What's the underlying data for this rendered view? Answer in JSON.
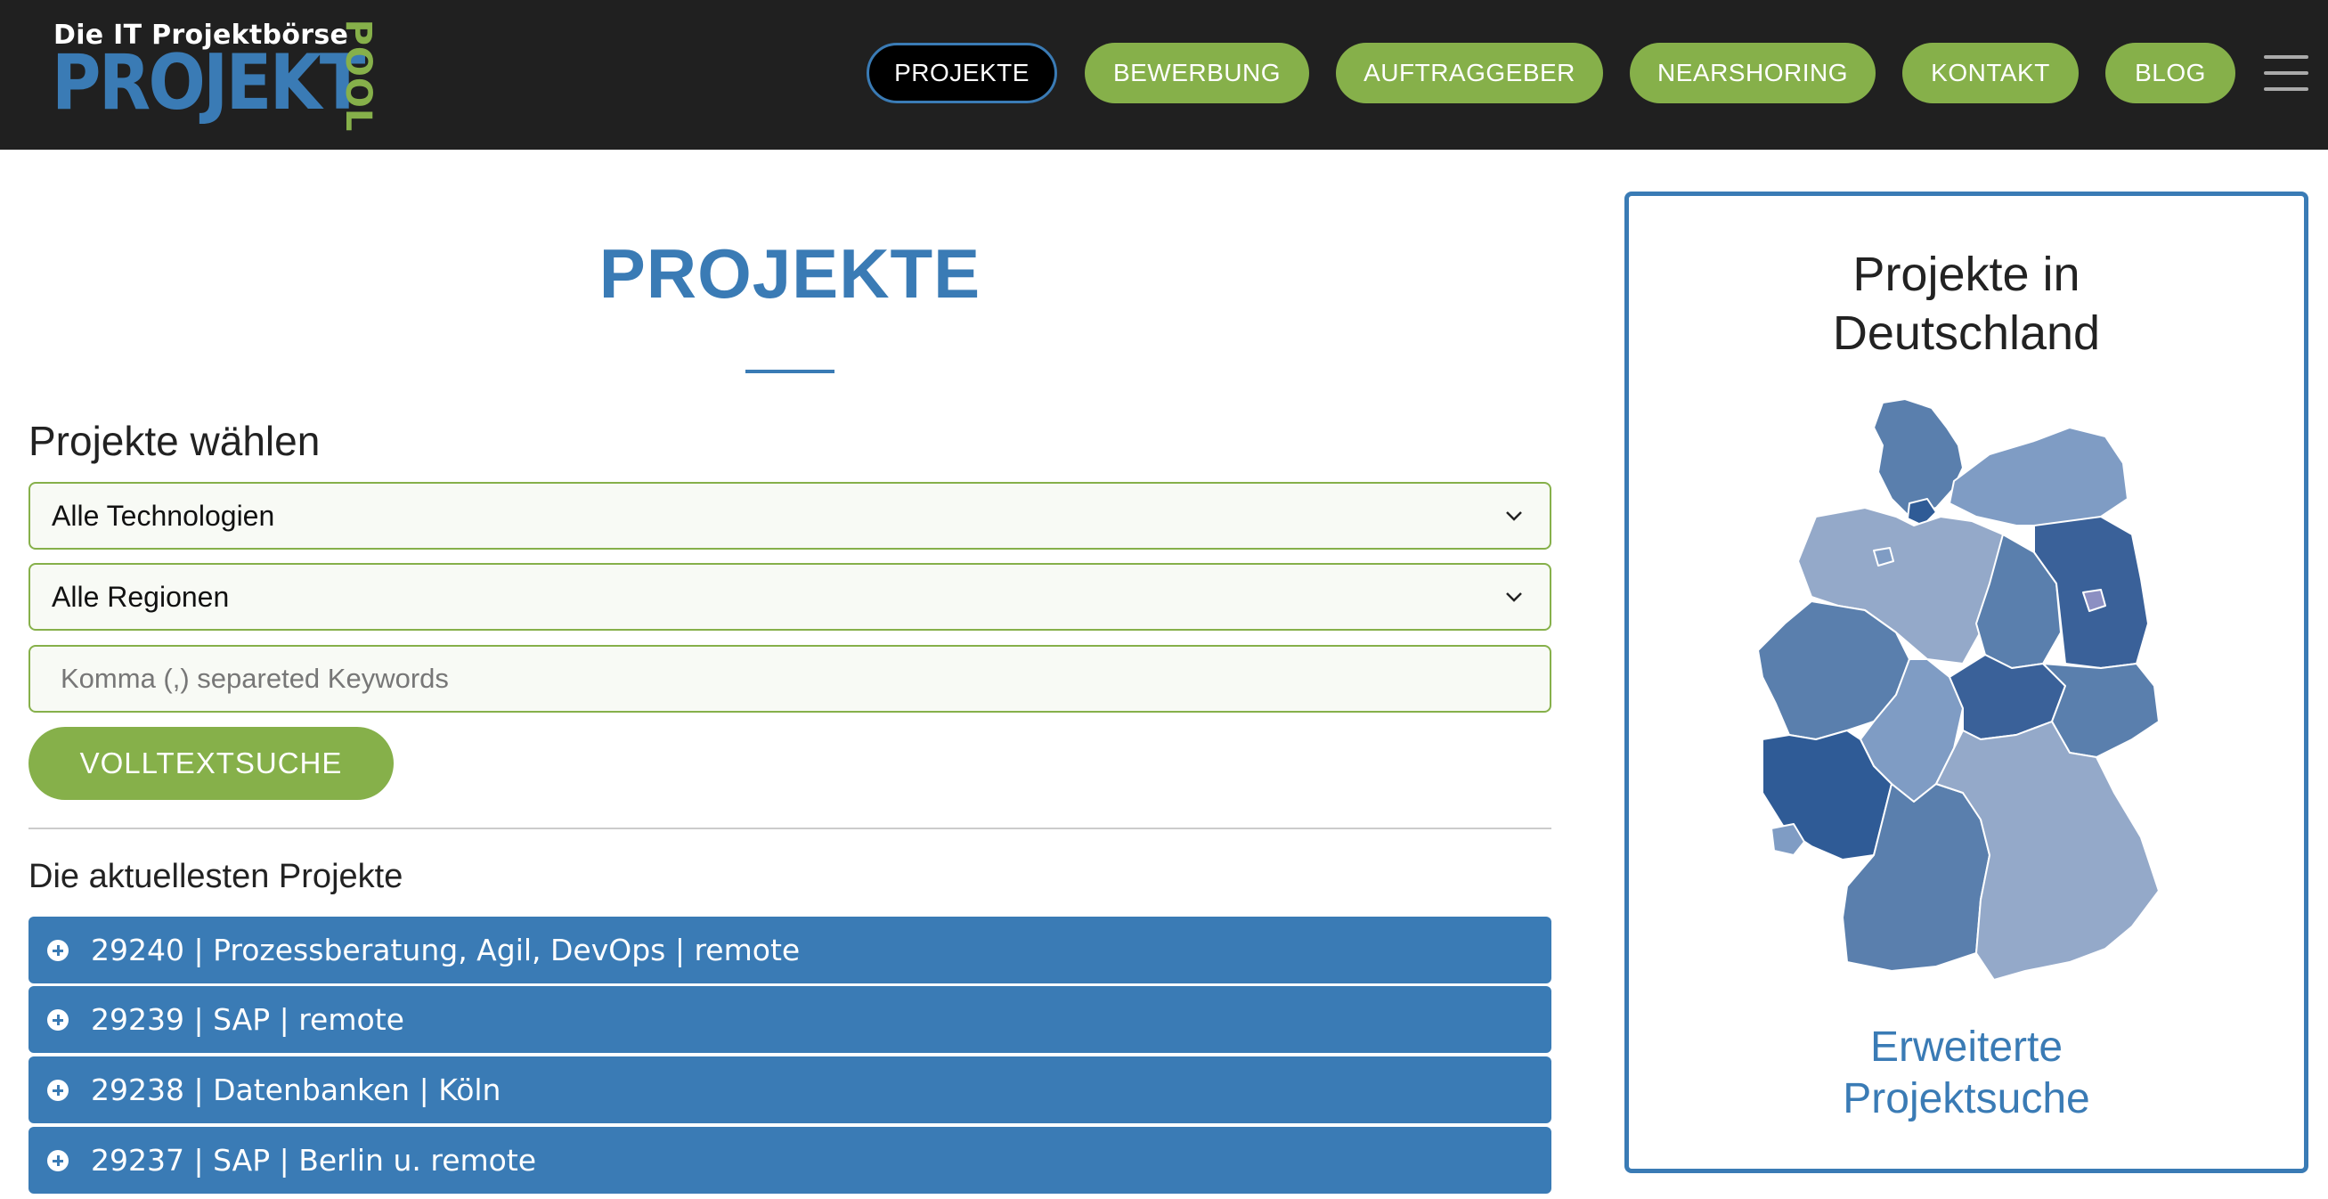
{
  "brand": {
    "tagline": "Die IT Projektbörse",
    "name": "PROJEKT",
    "suffix": "POOL"
  },
  "nav": [
    {
      "label": "PROJEKTE",
      "active": true
    },
    {
      "label": "BEWERBUNG",
      "active": false
    },
    {
      "label": "AUFTRAGGEBER",
      "active": false
    },
    {
      "label": "NEARSHORING",
      "active": false
    },
    {
      "label": "KONTAKT",
      "active": false
    },
    {
      "label": "BLOG",
      "active": false
    }
  ],
  "menu_icon": "hamburger-icon",
  "page": {
    "title": "PROJEKTE"
  },
  "filter": {
    "heading": "Projekte wählen",
    "technology": {
      "selected": "Alle Technologien"
    },
    "region": {
      "selected": "Alle Regionen"
    },
    "keywords": {
      "placeholder": "Komma (,) separeted Keywords",
      "value": ""
    },
    "search_label": "VOLLTEXTSUCHE"
  },
  "latest": {
    "heading": "Die aktuellesten Projekte",
    "items": [
      "29240 | Prozessberatung, Agil, DevOps | remote",
      "29239 | SAP | remote",
      "29238 | Datenbanken | Köln",
      "29237 | SAP | Berlin u. remote"
    ]
  },
  "sidebar": {
    "title_line1": "Projekte in",
    "title_line2": "Deutschland",
    "link_line1": "Erweiterte",
    "link_line2": "Projektsuche"
  },
  "colors": {
    "header_bg": "#202020",
    "accent_blue": "#3a7bb5",
    "accent_green": "#86b04a"
  }
}
